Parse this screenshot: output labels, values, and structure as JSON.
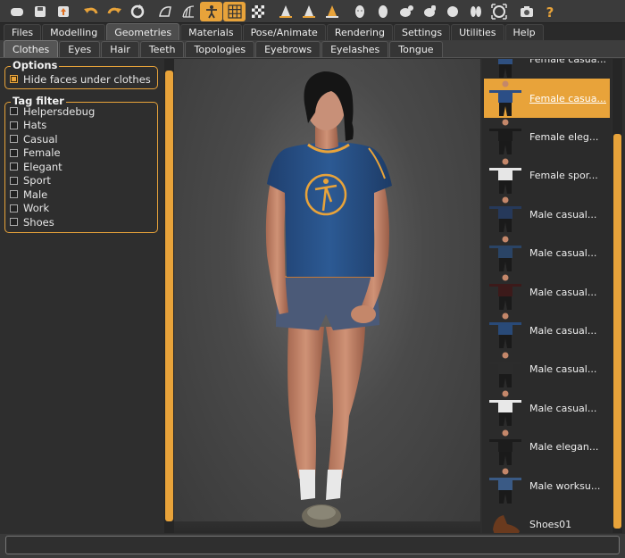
{
  "toolbar": {
    "icons": [
      "undo-icon",
      "redo-icon",
      "reset-icon",
      "smooth-icon",
      "wireframe-icon",
      "pose-icon",
      "grid-icon",
      "checker-icon",
      "front-view-icon",
      "back-view-icon",
      "left-view-icon",
      "head-icon",
      "sphere-icon",
      "camera-rotate-icon",
      "camera-zoom-icon",
      "fit-icon",
      "symmetry-icon",
      "frame-icon",
      "screenshot-icon",
      "help-icon"
    ]
  },
  "main_tabs": [
    "Files",
    "Modelling",
    "Geometries",
    "Materials",
    "Pose/Animate",
    "Rendering",
    "Settings",
    "Utilities",
    "Help"
  ],
  "sub_tabs": [
    "Clothes",
    "Eyes",
    "Hair",
    "Teeth",
    "Topologies",
    "Eyebrows",
    "Eyelashes",
    "Tongue"
  ],
  "options": {
    "title": "Options",
    "hide_faces_label": "Hide faces under clothes"
  },
  "tag_filter": {
    "title": "Tag filter",
    "tags": [
      "Helpersdebug",
      "Hats",
      "Casual",
      "Female",
      "Elegant",
      "Sport",
      "Male",
      "Work",
      "Shoes"
    ]
  },
  "clothes_list": [
    {
      "label": "Female casua...",
      "color": "#2f5080"
    },
    {
      "label": "Female casua...",
      "color": "#2b4e86"
    },
    {
      "label": "Female eleg...",
      "color": "#1b1b1b"
    },
    {
      "label": "Female spor...",
      "color": "#e6e6e6"
    },
    {
      "label": "Male casual...",
      "color": "#26395a"
    },
    {
      "label": "Male casual...",
      "color": "#2a4466"
    },
    {
      "label": "Male casual...",
      "color": "#3c1a1a"
    },
    {
      "label": "Male casual...",
      "color": "#294a78"
    },
    {
      "label": "Male casual...",
      "color": "#2c2c2c"
    },
    {
      "label": "Male casual...",
      "color": "#e8e8e8"
    },
    {
      "label": "Male elegan...",
      "color": "#1c1c1c"
    },
    {
      "label": "Male worksu...",
      "color": "#3a5a85"
    },
    {
      "label": "Shoes01",
      "color": "#6a3a1e"
    }
  ],
  "colors": {
    "accent": "#e8a33a",
    "shirt": "#2a5388",
    "shorts": "#4b5a78",
    "skin": "#c4876a",
    "hair": "#151515"
  }
}
